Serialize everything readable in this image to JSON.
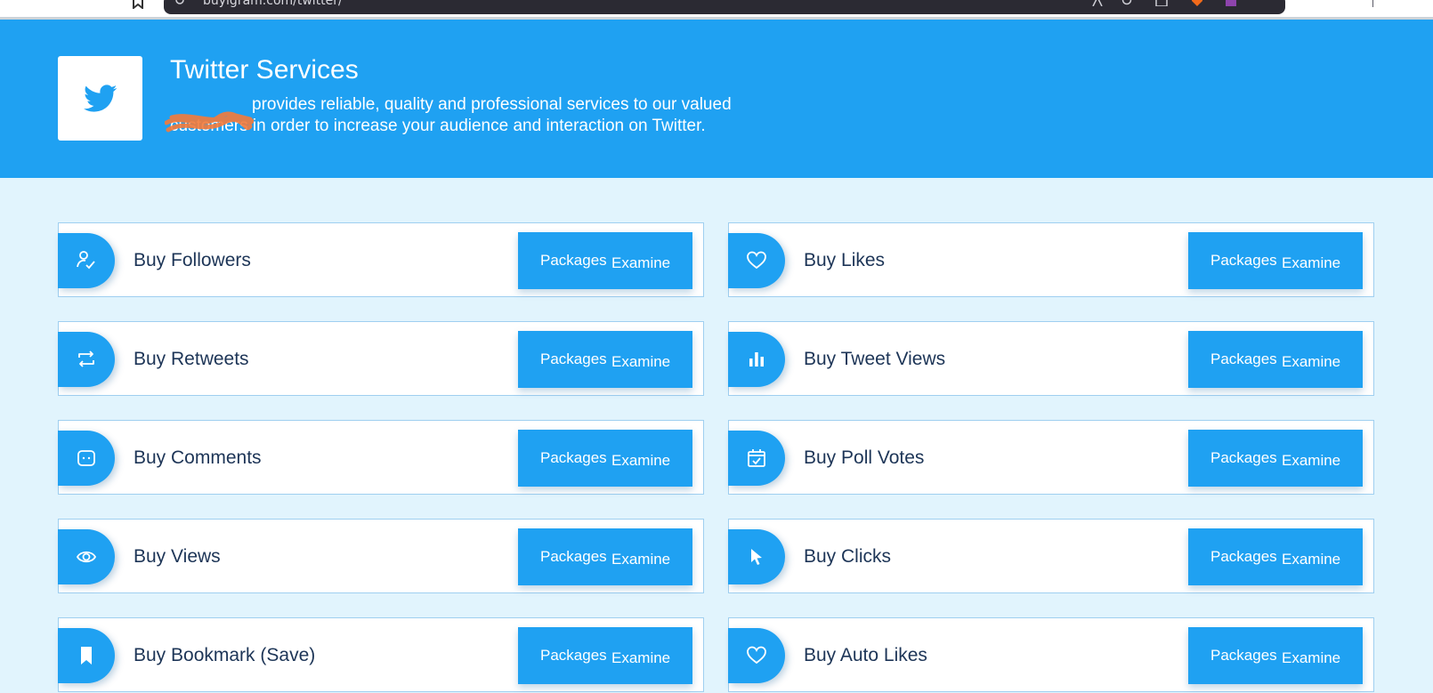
{
  "browser": {
    "url": "buyigram.com/twitter/"
  },
  "hero": {
    "title": "Twitter Services",
    "description": "provides reliable, quality and professional services to our valued customers in order to increase your audience and interaction on Twitter.",
    "brand_color": "#1fa1f2",
    "logo_icon": "twitter-bird-icon"
  },
  "button": {
    "word1": "Packages",
    "word2": "Examine"
  },
  "services": [
    {
      "title": "Buy Followers",
      "icon": "user-check-icon"
    },
    {
      "title": "Buy Likes",
      "icon": "heart-icon"
    },
    {
      "title": "Buy Retweets",
      "icon": "retweet-icon"
    },
    {
      "title": "Buy Tweet Views",
      "icon": "bar-chart-icon"
    },
    {
      "title": "Buy Comments",
      "icon": "comment-icon"
    },
    {
      "title": "Buy Poll Votes",
      "icon": "calendar-check-icon"
    },
    {
      "title": "Buy Views",
      "icon": "eye-icon"
    },
    {
      "title": "Buy Clicks",
      "icon": "cursor-icon"
    },
    {
      "title": "Buy Bookmark (Save)",
      "icon": "bookmark-icon"
    },
    {
      "title": "Buy Auto Likes",
      "icon": "heart-icon"
    }
  ]
}
